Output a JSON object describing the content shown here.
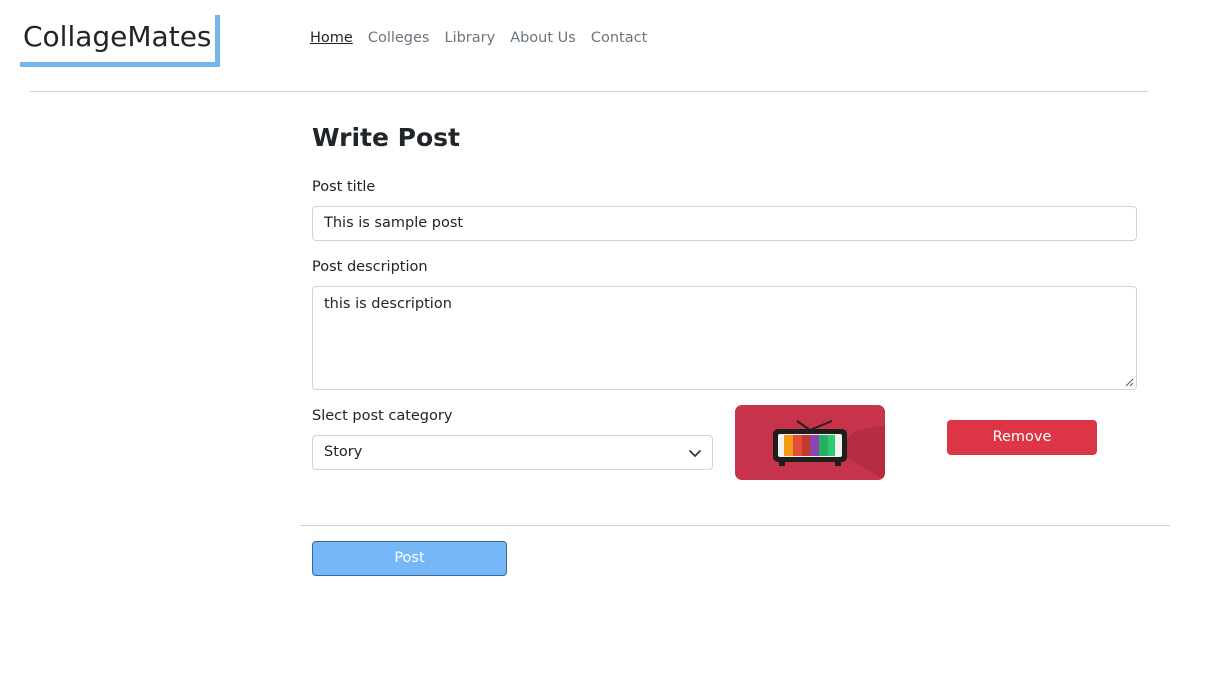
{
  "header": {
    "logo_text": "CollageMates",
    "nav": [
      {
        "label": "Home",
        "active": true
      },
      {
        "label": "Colleges",
        "active": false
      },
      {
        "label": "Library",
        "active": false
      },
      {
        "label": "About Us",
        "active": false
      },
      {
        "label": "Contact",
        "active": false
      }
    ]
  },
  "form": {
    "heading": "Write Post",
    "title_label": "Post title",
    "title_value": "This is sample post",
    "description_label": "Post description",
    "description_value": "this is description",
    "category_label": "Slect post category",
    "category_value": "Story",
    "image_icon": "retro-tv-icon",
    "remove_label": "Remove",
    "post_label": "Post"
  },
  "colors": {
    "accent": "#77b6ec",
    "remove": "#dc3545",
    "post": "#75b7f7",
    "thumbnail": "#c7334a"
  }
}
